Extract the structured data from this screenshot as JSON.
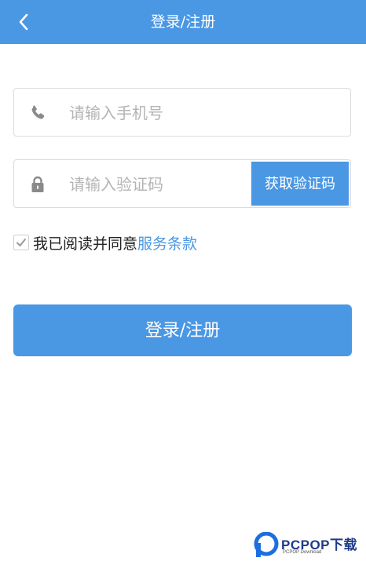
{
  "header": {
    "title": "登录/注册",
    "back_icon": "chevron-left-icon"
  },
  "form": {
    "phone": {
      "icon": "phone-icon",
      "placeholder": "请输入手机号",
      "value": ""
    },
    "code": {
      "icon": "lock-icon",
      "placeholder": "请输入验证码",
      "value": "",
      "button_label": "获取验证码"
    },
    "agreement": {
      "checked": true,
      "text": "我已阅读并同意",
      "link_text": "服务条款"
    },
    "submit_label": "登录/注册"
  },
  "watermark": {
    "title": "PCPOP下载",
    "subtitle": "PCPOP Download"
  },
  "colors": {
    "primary": "#4a97e4",
    "border": "#dcdcdc",
    "placeholder": "#b4b4b4",
    "icon_gray": "#8a8a8a"
  }
}
